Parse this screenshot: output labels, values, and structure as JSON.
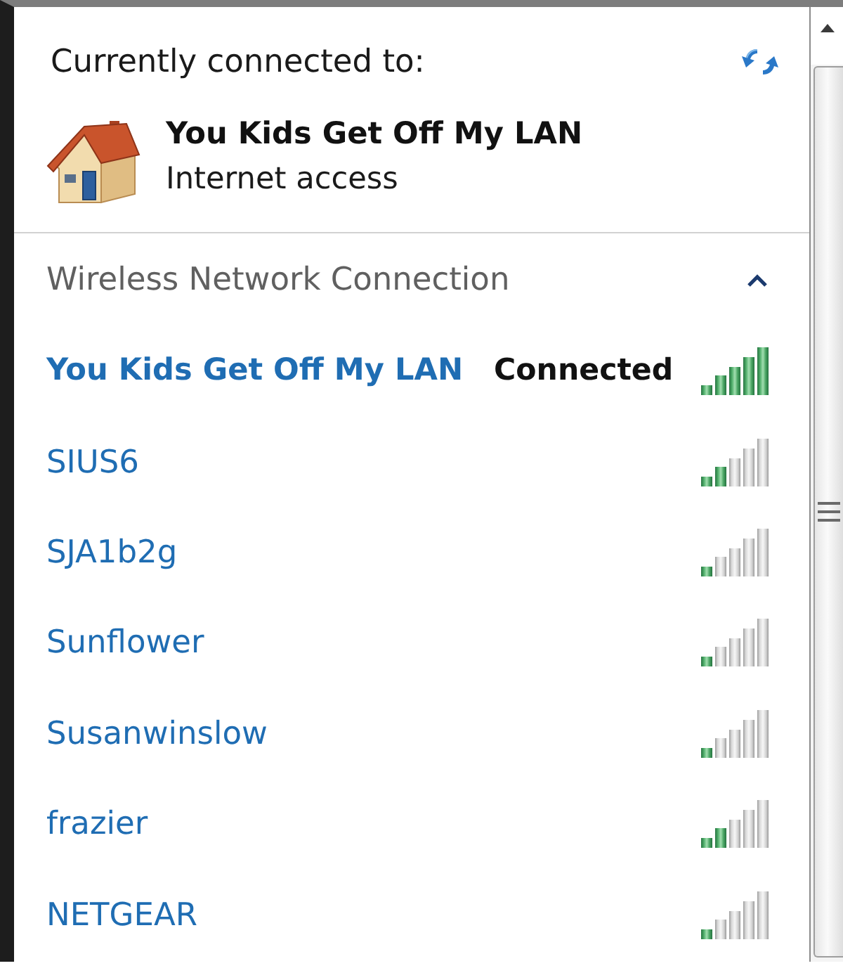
{
  "header": {
    "label": "Currently connected to:",
    "network": {
      "name": "You Kids Get Off My LAN",
      "access": "Internet access"
    }
  },
  "section": {
    "title": "Wireless Network Connection",
    "expanded": true
  },
  "networks": [
    {
      "name": "You Kids Get Off My LAN",
      "connected": true,
      "status": "Connected",
      "level": 1
    },
    {
      "name": "SIUS6",
      "connected": false,
      "level": 0.4
    },
    {
      "name": "SJA1b2g",
      "connected": false,
      "level": 0.2
    },
    {
      "name": "Sunflower",
      "connected": false,
      "level": 0.2
    },
    {
      "name": "Susanwinslow",
      "connected": false,
      "level": 0.2
    },
    {
      "name": "frazier",
      "connected": false,
      "level": 0.4
    },
    {
      "name": "NETGEAR",
      "connected": false,
      "level": 0.2
    }
  ]
}
